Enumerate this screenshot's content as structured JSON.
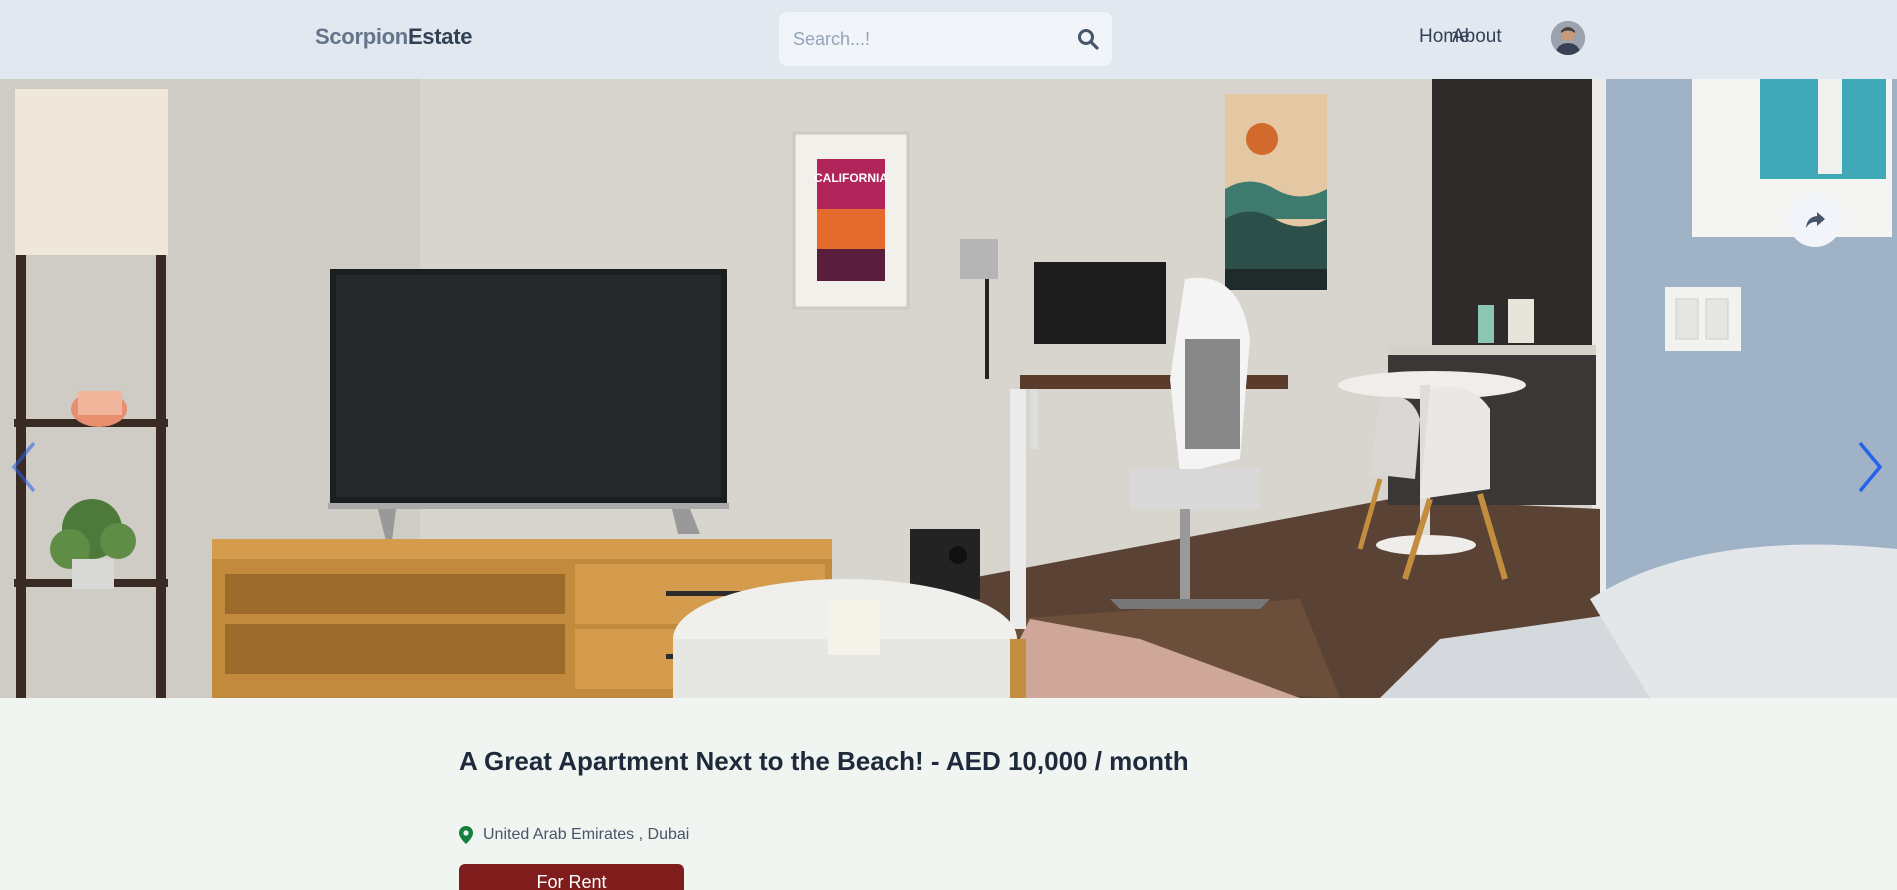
{
  "header": {
    "logo_part1": "Scorpion",
    "logo_part2": "Estate",
    "search_placeholder": "Search...!",
    "nav": {
      "home": "Home",
      "about": "About"
    }
  },
  "hero": {
    "poster_text": "CALIFORNIA",
    "icons": {
      "share": "share-icon",
      "prev": "chevron-left-icon",
      "next": "chevron-right-icon"
    }
  },
  "listing": {
    "title": "A Great Apartment Next to the Beach! - AED 10,000 / month",
    "location": "United Arab Emirates , Dubai",
    "type": "For Rent"
  },
  "colors": {
    "header_bg": "#e2e8f0",
    "page_bg": "#f1f5f1",
    "badge_bg": "#7f1d1d",
    "arrow_accent": "#2563eb",
    "pin_green": "#15803d"
  }
}
